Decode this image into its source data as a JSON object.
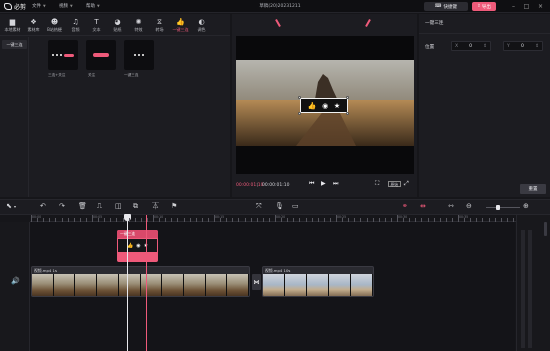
{
  "app": {
    "name": "必剪",
    "doc_title": "草稿(20)20231211",
    "quick_label": "快捷键",
    "export_label": "导出"
  },
  "menus": [
    {
      "label": "文件"
    },
    {
      "label": "视频"
    },
    {
      "label": "帮助"
    }
  ],
  "media_tabs": [
    {
      "label": "本地素材",
      "icon": "folder-icon"
    },
    {
      "label": "素材库",
      "icon": "library-icon"
    },
    {
      "label": "B站热梗",
      "icon": "meme-icon"
    },
    {
      "label": "音频",
      "icon": "audio-icon"
    },
    {
      "label": "文本",
      "icon": "text-icon"
    },
    {
      "label": "贴纸",
      "icon": "sticker-icon"
    },
    {
      "label": "特效",
      "icon": "effect-icon"
    },
    {
      "label": "转场",
      "icon": "transition-icon"
    },
    {
      "label": "一键三连",
      "icon": "thumb-icon"
    },
    {
      "label": "调色",
      "icon": "color-icon"
    }
  ],
  "side_category": "一键三连",
  "templates": [
    {
      "label": "三连+关注"
    },
    {
      "label": "关注"
    },
    {
      "label": "一键三连"
    }
  ],
  "player": {
    "current": "00:00:01:10",
    "total": "00:00:01:10",
    "ratio": "原始"
  },
  "props": {
    "title": "一键三连",
    "position_label": "位置",
    "x_axis": "X",
    "x_value": "0",
    "y_axis": "Y",
    "y_value": "0",
    "reset_label": "重置"
  },
  "timeline": {
    "ruler_labels": [
      "00:00",
      "00:05",
      "00:10",
      "00:15",
      "00:20",
      "00:25",
      "00:30",
      "00:35"
    ],
    "sticker_clip_label": "一键三连",
    "clip1_label": "视频.mp4  1s",
    "clip2_label": "视频.mp4  10s"
  },
  "colors": {
    "accent": "#ee5a7a",
    "panel": "#1c1c21",
    "background": "#16161a"
  }
}
